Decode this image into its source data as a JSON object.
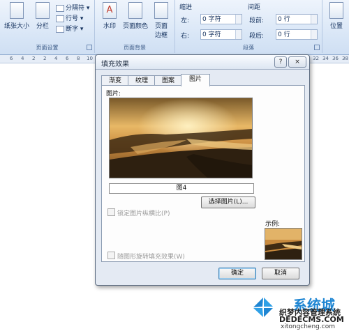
{
  "ribbon": {
    "page_setup": {
      "paper_size": "纸张大小",
      "columns": "分栏",
      "breaks": "分隔符",
      "line_numbers": "行号",
      "hyphenation": "断字",
      "group_label": "页面设置"
    },
    "page_background": {
      "watermark": "水印",
      "page_color": "页面颜色",
      "page_borders_line1": "页面",
      "page_borders_line2": "边框",
      "group_label": "页面背景"
    },
    "paragraph": {
      "indent_label": "缩进",
      "spacing_label": "间距",
      "left_label": "左:",
      "right_label": "右:",
      "left_value": "0 字符",
      "right_value": "0 字符",
      "before_label": "段前:",
      "after_label": "段后:",
      "before_value": "0 行",
      "after_value": "0 行",
      "group_label": "段落"
    },
    "arrange": {
      "position": "位置"
    }
  },
  "ruler": {
    "left_marks": [
      "6",
      "4",
      "2",
      "2",
      "4",
      "6",
      "8",
      "10",
      "12"
    ],
    "right_marks": [
      "32",
      "34",
      "36",
      "38"
    ]
  },
  "dialog": {
    "title": "填充效果",
    "help_button": "?",
    "close_button": "×",
    "tabs": [
      "渐变",
      "纹理",
      "图案",
      "图片"
    ],
    "active_tab": "图片",
    "picture_label": "图片:",
    "picture_name": "图4",
    "select_picture_button": "选择图片(L)...",
    "lock_aspect_label": "锁定图片纵横比(P)",
    "rotate_with_shape_label": "随图形旋转填充效果(W)",
    "sample_label": "示例:",
    "ok_button": "确定",
    "cancel_button": "取消"
  },
  "watermark": {
    "brand": "系统城",
    "line2": "织梦内容管理系统",
    "line3": "DEDECMS.COM",
    "line4": "xitongcheng.com"
  },
  "colors": {
    "ribbon_bg": "#d7e5f6",
    "dialog_bg": "#e4eaf3",
    "default_button_border": "#3c7fb1",
    "watermark_blue": "#1f86d3"
  }
}
